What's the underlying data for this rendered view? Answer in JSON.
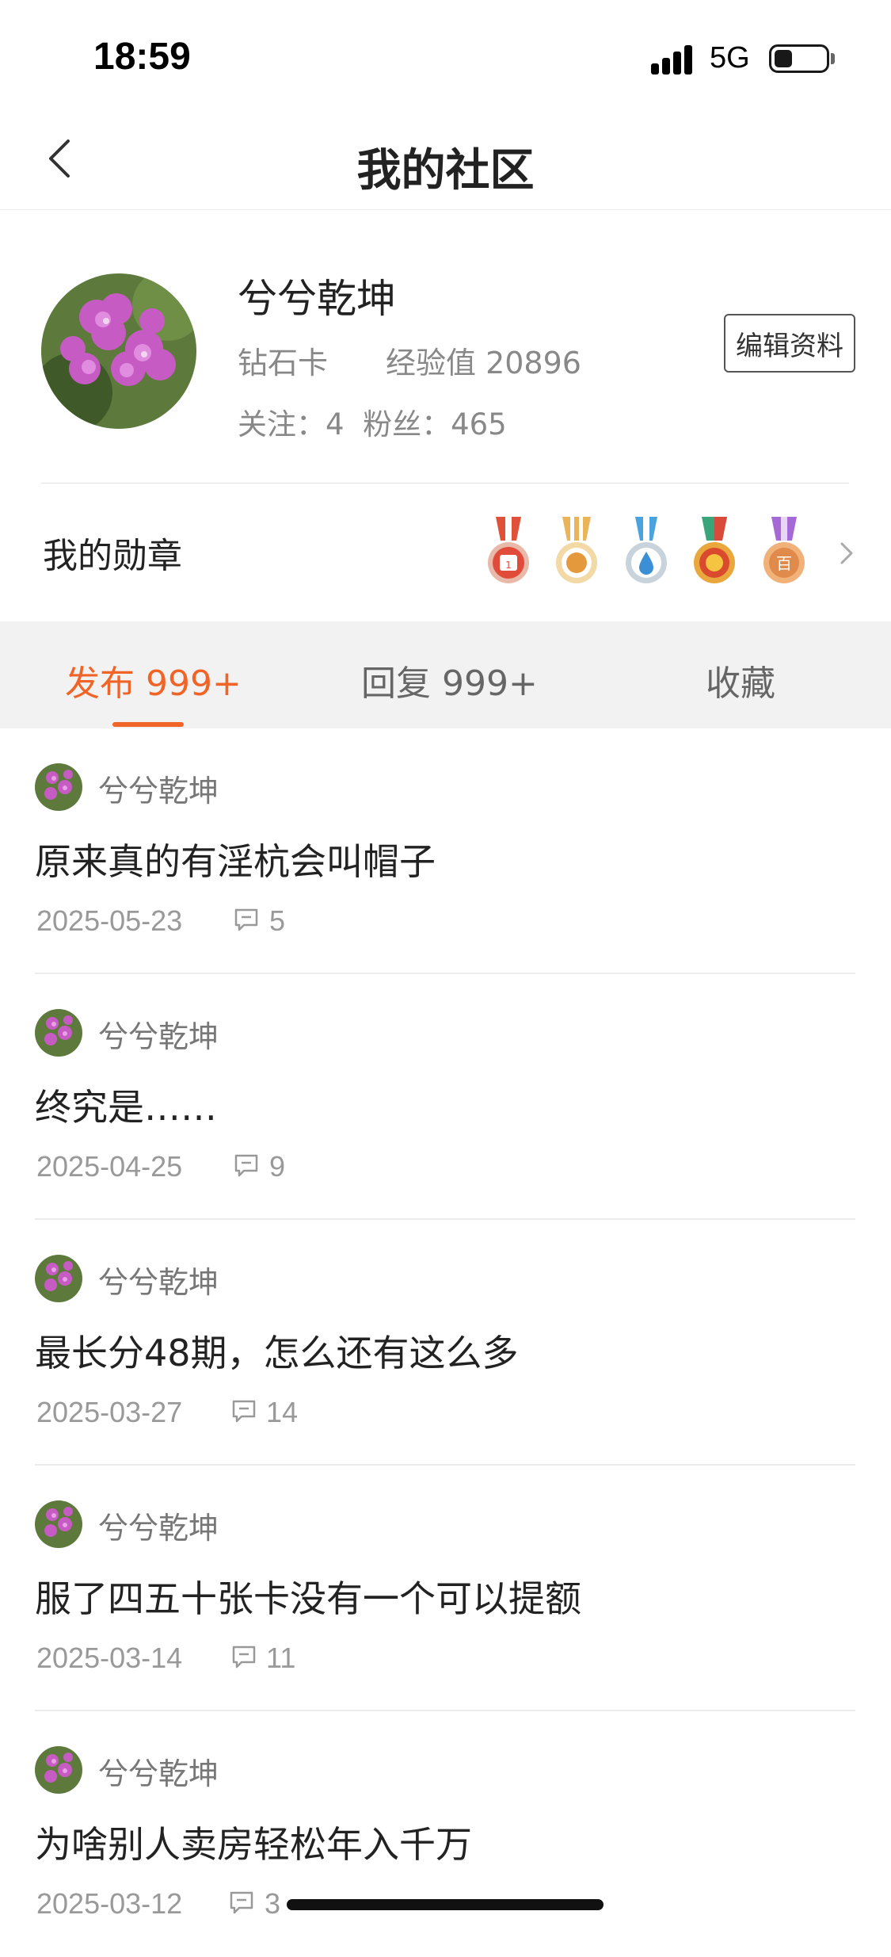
{
  "status_bar": {
    "time": "18:59",
    "network": "5G"
  },
  "nav": {
    "title": "我的社区"
  },
  "profile": {
    "username": "兮兮乾坤",
    "level": "钻石卡",
    "exp": "经验值 20896",
    "follow": "关注：4  粉丝：465",
    "edit_label": "编辑资料"
  },
  "medals": {
    "label": "我的勋章"
  },
  "tabs": [
    {
      "label": "发布 999+",
      "active": true
    },
    {
      "label": "回复 999+",
      "active": false
    },
    {
      "label": "收藏",
      "active": false
    }
  ],
  "posts": [
    {
      "author": "兮兮乾坤",
      "title": "原来真的有淫杭会叫帽子",
      "date": "2025-05-23",
      "comments": "5"
    },
    {
      "author": "兮兮乾坤",
      "title": "终究是……",
      "date": "2025-04-25",
      "comments": "9"
    },
    {
      "author": "兮兮乾坤",
      "title": "最长分48期，怎么还有这么多",
      "date": "2025-03-27",
      "comments": "14"
    },
    {
      "author": "兮兮乾坤",
      "title": "服了四五十张卡没有一个可以提额",
      "date": "2025-03-14",
      "comments": "11"
    },
    {
      "author": "兮兮乾坤",
      "title": "为啥别人卖房轻松年入千万",
      "date": "2025-03-12",
      "comments": "3"
    }
  ],
  "colors": {
    "accent": "#f06428",
    "muted": "#999999"
  }
}
